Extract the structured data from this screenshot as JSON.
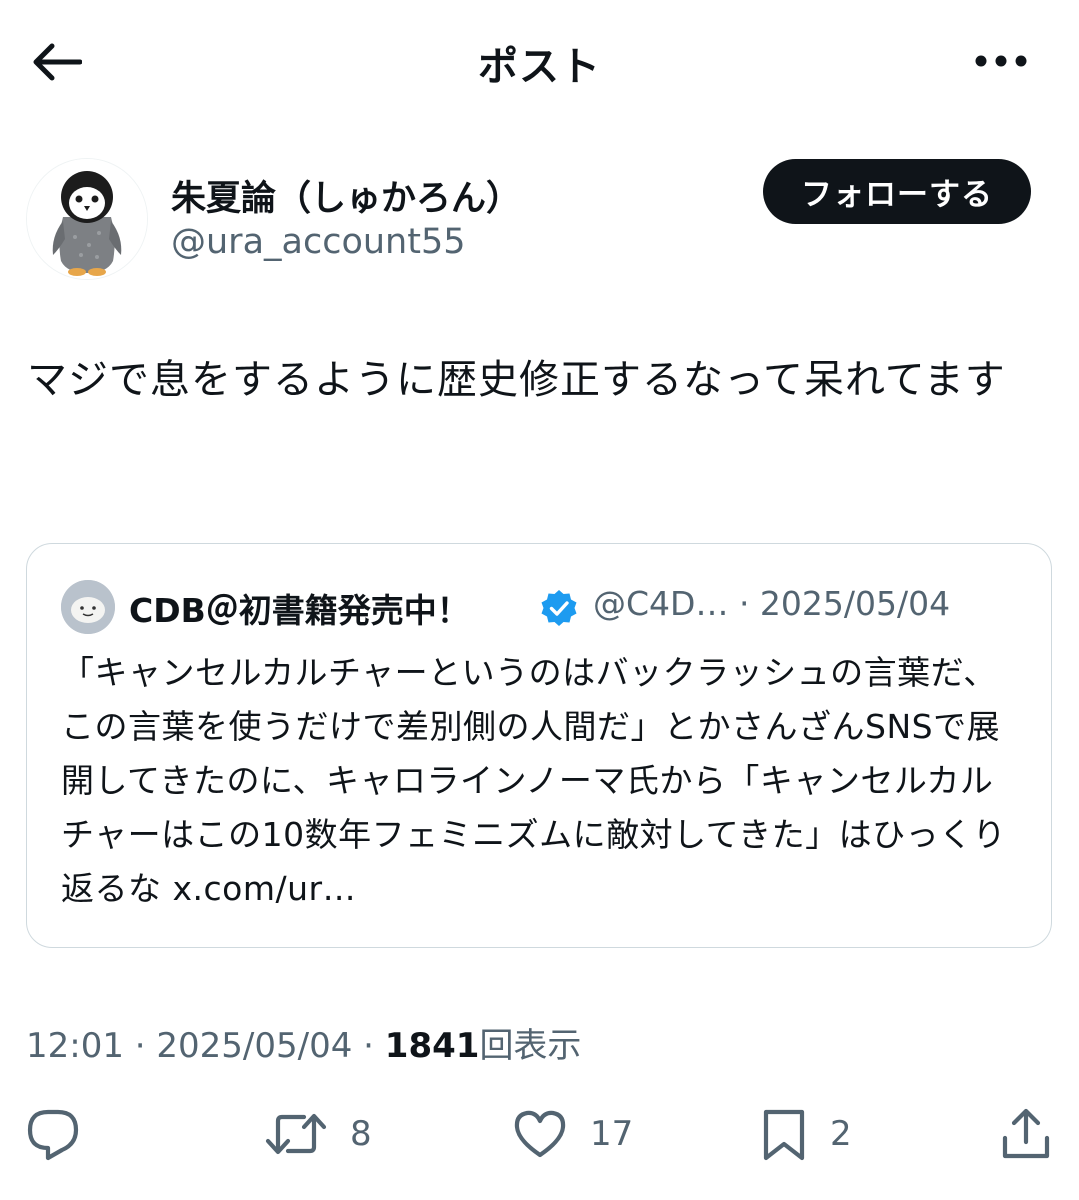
{
  "header": {
    "title": "ポスト",
    "back_icon": "arrow-left-icon",
    "more_icon": "more-horizontal-icon"
  },
  "author": {
    "display_name": "朱夏論（しゅかろん）",
    "handle": "@ura_account55",
    "avatar_icon": "penguin-avatar",
    "follow_label": "フォローする"
  },
  "post": {
    "text": "マジで息をするように歴史修正するなって呆れてます"
  },
  "quote": {
    "display_name": "CDB＠初書籍発売中！",
    "handle_date": "@C4D… · 2025/05/04",
    "verified_icon": "verified-badge-icon",
    "text": "「キャンセルカルチャーというのはバックラッシュの言葉だ、この言葉を使うだけで差別側の人間だ」とかさんざんSNSで展開してきたのに、キャロラインノーマ氏から「キャンセルカルチャーはこの10数年フェミニズムに敵対してきた」はひっくり返るな x.com/ur…"
  },
  "meta": {
    "time_date": "12:01 · 2025/05/04 · ",
    "views_count": "1841",
    "views_label": "回表示"
  },
  "actions": {
    "reply_count": "",
    "repost_count": "8",
    "like_count": "17",
    "bookmark_count": "2"
  },
  "colors": {
    "text": "#0f1419",
    "secondary": "#536471",
    "border": "#cfd9de",
    "verified": "#1d9bf0"
  }
}
